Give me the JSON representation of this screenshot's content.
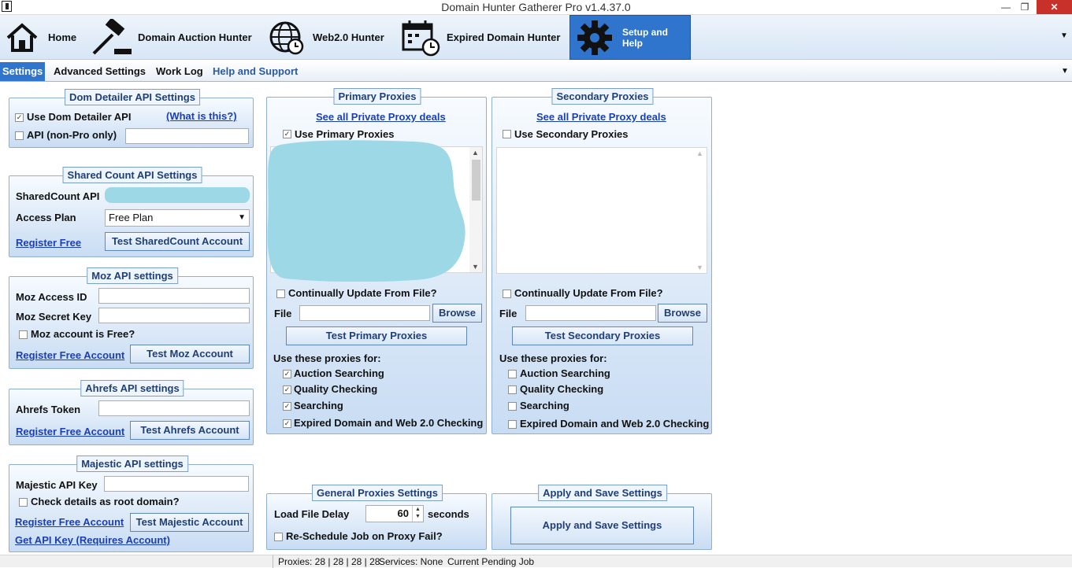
{
  "window": {
    "title": "Domain Hunter Gatherer Pro v1.4.37.0",
    "min": "—",
    "max": "❐",
    "close": "✕"
  },
  "ribbon": {
    "tabs": [
      {
        "label": "Home",
        "icon": "home-icon"
      },
      {
        "label": "Domain Auction Hunter",
        "icon": "gavel-icon"
      },
      {
        "label": "Web2.0 Hunter",
        "icon": "globe-clock-icon"
      },
      {
        "label": "Expired Domain Hunter",
        "icon": "calendar-clock-icon"
      },
      {
        "label": "Setup and Help",
        "icon": "gear-icon",
        "active": true
      }
    ]
  },
  "subtabs": [
    "Settings",
    "Advanced Settings",
    "Work Log",
    "Help and Support"
  ],
  "dom_detailer": {
    "title": "Dom Detailer API Settings",
    "use_label": "Use Dom Detailer API",
    "use_checked": true,
    "what_link": "(What is this?)",
    "api_label": "API (non-Pro only)",
    "api_value": ""
  },
  "shared_count": {
    "title": "Shared Count API Settings",
    "api_label": "SharedCount API",
    "plan_label": "Access Plan",
    "plan_value": "Free Plan",
    "register": "Register Free",
    "test": "Test SharedCount Account"
  },
  "moz": {
    "title": "Moz API settings",
    "access_label": "Moz Access ID",
    "secret_label": "Moz Secret Key",
    "free_label": "Moz account is Free?",
    "register": "Register Free Account",
    "test": "Test Moz Account"
  },
  "ahrefs": {
    "title": "Ahrefs API settings",
    "token_label": "Ahrefs Token",
    "register": "Register Free Account",
    "test": "Test Ahrefs Account"
  },
  "majestic": {
    "title": "Majestic API settings",
    "key_label": "Majestic API Key",
    "root_label": "Check details as root domain?",
    "register": "Register Free Account",
    "test": "Test Majestic Account",
    "get_key": "Get API Key (Requires Account)"
  },
  "primary": {
    "title": "Primary Proxies",
    "deals_link": "See all Private Proxy deals",
    "use_label": "Use Primary Proxies",
    "use_checked": true,
    "update_label": "Continually Update From File?",
    "file_label": "File",
    "browse": "Browse",
    "test": "Test Primary Proxies",
    "use_for": "Use these proxies for:",
    "options": [
      {
        "label": "Auction Searching",
        "checked": true
      },
      {
        "label": "Quality Checking",
        "checked": true
      },
      {
        "label": "Searching",
        "checked": true
      },
      {
        "label": "Expired Domain and Web 2.0 Checking",
        "checked": true
      }
    ]
  },
  "secondary": {
    "title": "Secondary Proxies",
    "deals_link": "See all Private Proxy deals",
    "use_label": "Use Secondary Proxies",
    "use_checked": false,
    "update_label": "Continually Update From File?",
    "file_label": "File",
    "browse": "Browse",
    "test": "Test Secondary Proxies",
    "use_for": "Use these proxies for:",
    "options": [
      {
        "label": "Auction Searching",
        "checked": false
      },
      {
        "label": "Quality Checking",
        "checked": false
      },
      {
        "label": "Searching",
        "checked": false
      },
      {
        "label": "Expired Domain and Web 2.0 Checking",
        "checked": false
      }
    ]
  },
  "general": {
    "title": "General Proxies Settings",
    "delay_label": "Load File Delay",
    "delay_value": "60",
    "delay_unit": "seconds",
    "reschedule_label": "Re-Schedule Job on Proxy Fail?"
  },
  "apply": {
    "title": "Apply and Save Settings",
    "button": "Apply and Save Settings"
  },
  "status": {
    "proxies": "Proxies: 28 | 28 | 28 | 28",
    "services": "Services: None",
    "pending": "Current Pending Job"
  },
  "colors": {
    "accent": "#2f74cd",
    "link": "#1a3fb6",
    "redaction": "#9dd8e6"
  }
}
